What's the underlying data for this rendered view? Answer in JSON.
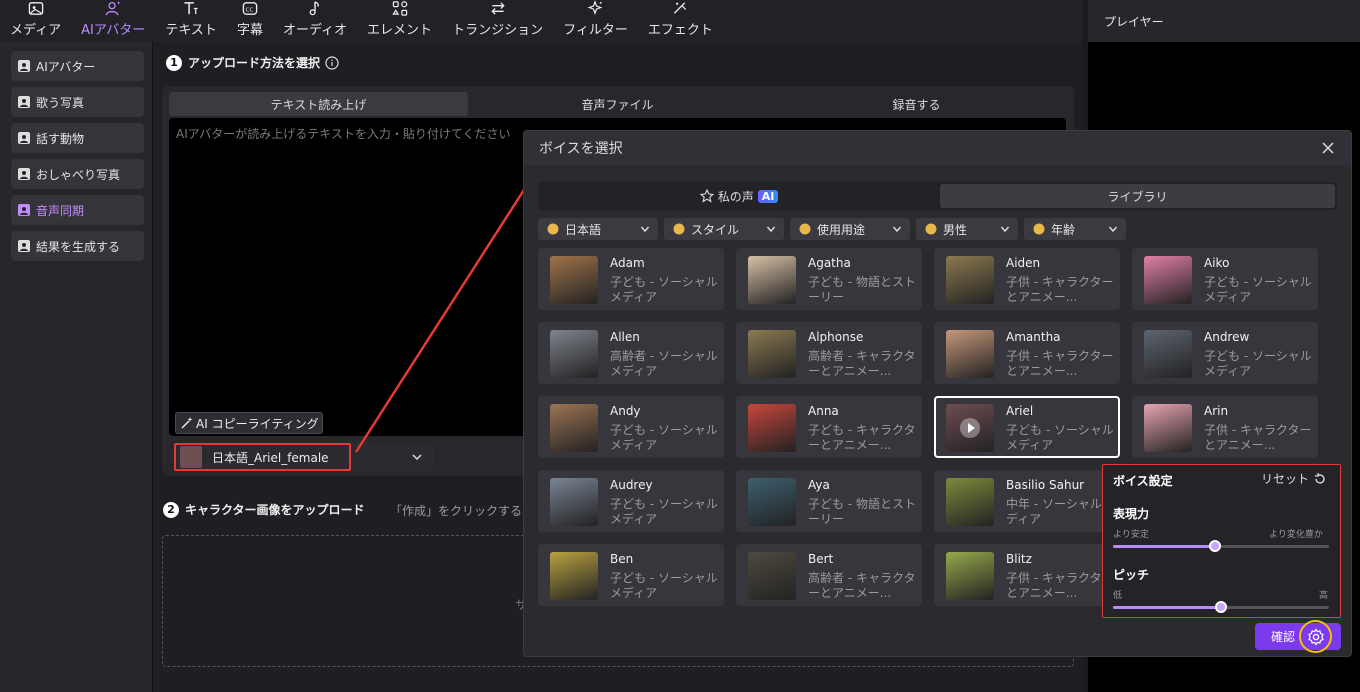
{
  "toolbar": {
    "items": [
      {
        "label": "メディア",
        "icon": "media-icon"
      },
      {
        "label": "AIアバター",
        "icon": "avatar-icon",
        "active": true
      },
      {
        "label": "テキスト",
        "icon": "text-icon"
      },
      {
        "label": "字幕",
        "icon": "subtitle-icon"
      },
      {
        "label": "オーディオ",
        "icon": "audio-icon"
      },
      {
        "label": "エレメント",
        "icon": "element-icon"
      },
      {
        "label": "トランジション",
        "icon": "transition-icon"
      },
      {
        "label": "フィルター",
        "icon": "filter-icon"
      },
      {
        "label": "エフェクト",
        "icon": "effect-icon"
      }
    ]
  },
  "sidebar": {
    "items": [
      {
        "label": "AIアバター"
      },
      {
        "label": "歌う写真"
      },
      {
        "label": "話す動物"
      },
      {
        "label": "おしゃべり写真"
      },
      {
        "label": "音声同期",
        "active": true
      },
      {
        "label": "結果を生成する"
      }
    ]
  },
  "step1": {
    "num": "1",
    "title": "アップロード方法を選択"
  },
  "input_tabs": [
    "テキスト読み上げ",
    "音声ファイル",
    "録音する"
  ],
  "textarea": {
    "placeholder": "AIアバターが読み上げるテキストを入力・貼り付けてください"
  },
  "copy_button": "AI コピーライティング",
  "voice_select": {
    "value": "日本語_Ariel_female"
  },
  "step2": {
    "num": "2",
    "title": "キャラクター画像をアップロード",
    "hint": "「作成」をクリックすると",
    "drop_hint": "サ"
  },
  "player": {
    "title": "プレイヤー"
  },
  "dialog": {
    "title": "ボイスを選択",
    "tabs": {
      "my_voice": "私の声",
      "ai_badge": "AI",
      "library": "ライブラリ"
    },
    "filters": [
      "日本語",
      "スタイル",
      "使用用途",
      "男性",
      "年齢"
    ],
    "cards": [
      {
        "name": "Adam",
        "desc": "子ども - ソーシャルメディア",
        "color": "#a0744a"
      },
      {
        "name": "Agatha",
        "desc": "子ども - 物語とストーリー",
        "color": "#d8c1a5"
      },
      {
        "name": "Aiden",
        "desc": "子供 - キャラクターとアニメー...",
        "color": "#8c7a4f"
      },
      {
        "name": "Aiko",
        "desc": "子ども - ソーシャルメディア",
        "color": "#e27fa8"
      },
      {
        "name": "Allen",
        "desc": "高齢者 - ソーシャルメディア",
        "color": "#7f838c"
      },
      {
        "name": "Alphonse",
        "desc": "高齢者 - キャラクターとアニメー...",
        "color": "#8b7a52"
      },
      {
        "name": "Amantha",
        "desc": "子供 - キャラクターとアニメー...",
        "color": "#c7987a"
      },
      {
        "name": "Andrew",
        "desc": "子ども - ソーシャルメディア",
        "color": "#5d6470"
      },
      {
        "name": "Andy",
        "desc": "子ども - ソーシャルメディア",
        "color": "#9c7454"
      },
      {
        "name": "Anna",
        "desc": "子ども - キャラクターとアニメー...",
        "color": "#c8463b"
      },
      {
        "name": "Ariel",
        "desc": "子ども - ソーシャルメディア",
        "color": "#6e4d53",
        "selected": true
      },
      {
        "name": "Arin",
        "desc": "子供 - キャラクターとアニメー...",
        "color": "#e7a4b0"
      },
      {
        "name": "Audrey",
        "desc": "子ども - ソーシャルメディア",
        "color": "#7a8494"
      },
      {
        "name": "Aya",
        "desc": "子ども - 物語とストーリー",
        "color": "#3c5f6e"
      },
      {
        "name": "Basilio Sahur",
        "desc": "中年 - ソーシャルメディア",
        "color": "#7e8a3c"
      },
      {
        "name": "",
        "desc": "",
        "color": "#36363c",
        "hidden": true
      },
      {
        "name": "Ben",
        "desc": "子ども - ソーシャルメディア",
        "color": "#b9a23f"
      },
      {
        "name": "Bert",
        "desc": "高齢者 - キャラクターとアニメー...",
        "color": "#4f4a3f"
      },
      {
        "name": "Blitz",
        "desc": "子供 - キャラクターとアニメー...",
        "color": "#96a94c"
      }
    ],
    "confirm": "確認"
  },
  "settings": {
    "title": "ボイス設定",
    "reset": "リセット",
    "expr": {
      "label": "表現力",
      "left": "より安定",
      "right": "より変化豊か",
      "value": 0.47
    },
    "pitch": {
      "label": "ピッチ",
      "left": "低",
      "right": "高",
      "value": 0.5
    }
  },
  "colors": {
    "accent": "#b98cff",
    "primary": "#7c3aed",
    "highlight": "#e53935",
    "gear_ring": "#f2c200"
  }
}
